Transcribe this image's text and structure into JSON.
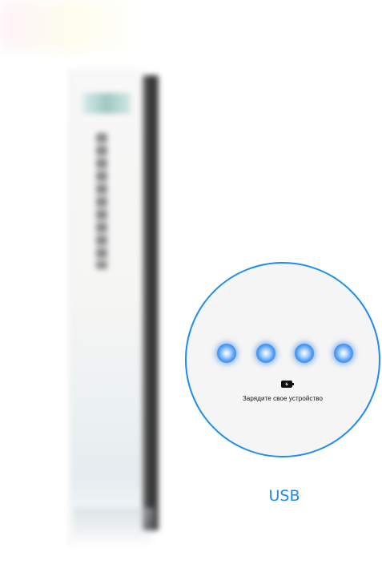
{
  "usb_panel": {
    "message": "Зарядите свое устройство",
    "battery_icon": "battery-charging-icon",
    "indicator_count": 4,
    "accent_color": "#1d8cf0"
  },
  "caption": {
    "label": "USB"
  },
  "device": {
    "icon": "usb-device-image"
  }
}
